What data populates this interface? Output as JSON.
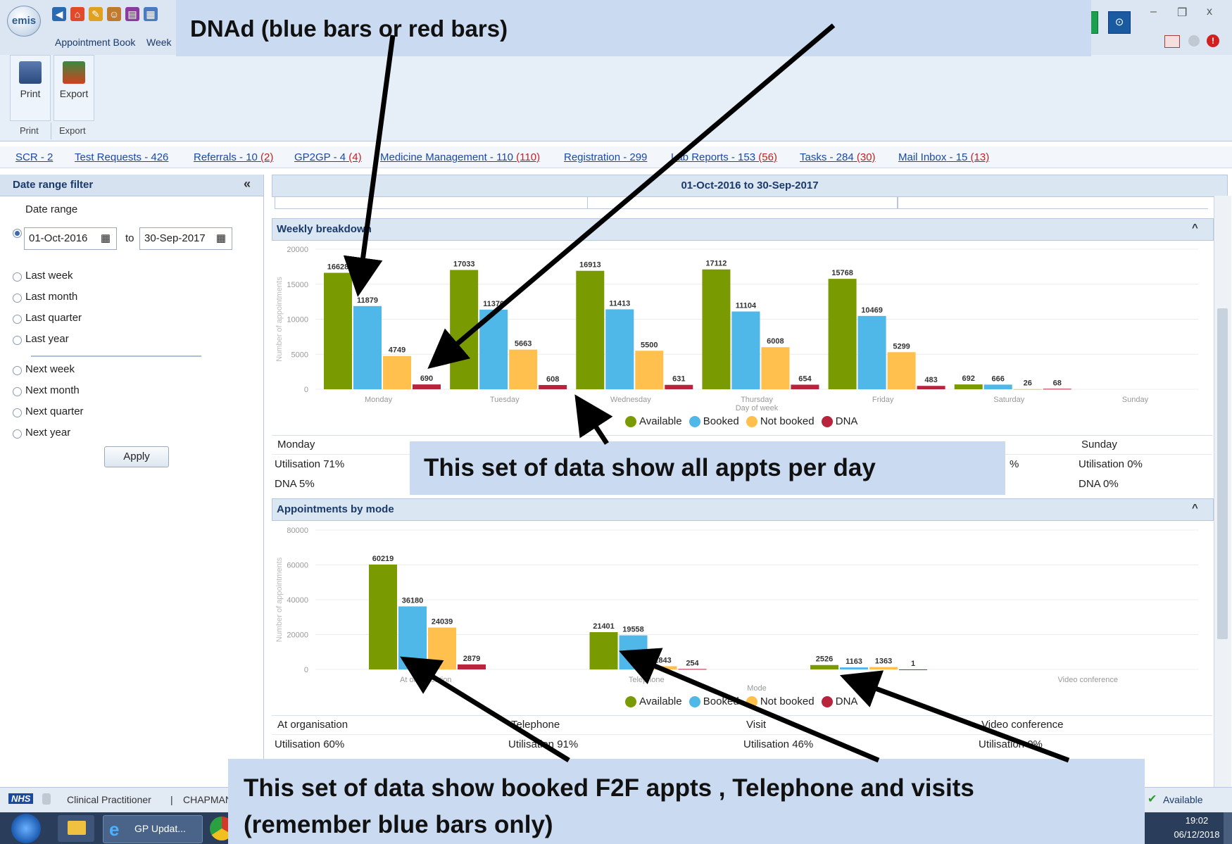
{
  "app": {
    "logo": "emis",
    "menu_tabs": [
      "Appointment Book",
      "Week"
    ],
    "ribbon_buttons": [
      {
        "label": "Print",
        "icon": "printer-icon"
      },
      {
        "label": "Export",
        "icon": "export-icon"
      }
    ],
    "ribbon_groups": [
      "Print",
      "Export"
    ]
  },
  "links": [
    {
      "label": "SCR",
      "count": " - 2",
      "extra": ""
    },
    {
      "label": "Test Requests",
      "count": " - 426",
      "extra": ""
    },
    {
      "label": "Referrals",
      "count": " - 10",
      "extra": " (2)"
    },
    {
      "label": "GP2GP",
      "count": " - 4",
      "extra": " (4)"
    },
    {
      "label": "Medicine Management",
      "count": " - 110",
      "extra": " (110)"
    },
    {
      "label": "Registration",
      "count": " - 299",
      "extra": ""
    },
    {
      "label": "Lab Reports",
      "count": " - 153",
      "extra": " (56)"
    },
    {
      "label": "Tasks",
      "count": " - 284",
      "extra": " (30)"
    },
    {
      "label": "Mail Inbox",
      "count": " - 15",
      "extra": " (13)"
    }
  ],
  "filter": {
    "title": "Date range filter",
    "collapse": "«",
    "date_range_label": "Date range",
    "from": "01-Oct-2016",
    "to_label": "to",
    "to": "30-Sep-2017",
    "options_past": [
      "Last week",
      "Last month",
      "Last quarter",
      "Last year"
    ],
    "options_next": [
      "Next week",
      "Next month",
      "Next quarter",
      "Next year"
    ],
    "apply": "Apply"
  },
  "main": {
    "period": "01-Oct-2016 to 30-Sep-2017",
    "weekly_title": "Weekly breakdown",
    "mode_title": "Appointments by mode",
    "collapse_icon": "^",
    "weekly_summary": [
      {
        "day": "Monday",
        "util": "Utilisation 71%",
        "dna": "DNA 5%"
      },
      {
        "day": "Sunday",
        "util": "Utilisation 0%",
        "dna": "DNA 0%"
      }
    ],
    "mode_summary": [
      {
        "mode": "At organisation",
        "util": "Utilisation 60%"
      },
      {
        "mode": "Telephone",
        "util": "Utilisation 91%"
      },
      {
        "mode": "Visit",
        "util": "Utilisation 46%"
      },
      {
        "mode": "Video conference",
        "util": "Utilisation 0%"
      }
    ],
    "partial_right_weekly": "%"
  },
  "legend": [
    "Available",
    "Booked",
    "Not booked",
    "DNA"
  ],
  "colors": {
    "available": "#7a9a01",
    "booked": "#4fb8e8",
    "not_booked": "#ffc04d",
    "dna": "#b8243c"
  },
  "chart_data": [
    {
      "type": "bar",
      "ylabel": "Number of appointments",
      "xlabel": "Day of week",
      "ylim": [
        0,
        20000
      ],
      "yticks": [
        0,
        5000,
        10000,
        15000,
        20000
      ],
      "categories": [
        "Monday",
        "Tuesday",
        "Wednesday",
        "Thursday",
        "Friday",
        "Saturday",
        "Sunday"
      ],
      "series": [
        {
          "name": "Available",
          "values": [
            16628,
            17033,
            16913,
            17112,
            15768,
            692,
            0
          ]
        },
        {
          "name": "Booked",
          "values": [
            11879,
            11370,
            11413,
            11104,
            10469,
            666,
            0
          ]
        },
        {
          "name": "Not booked",
          "values": [
            4749,
            5663,
            5500,
            6008,
            5299,
            26,
            0
          ]
        },
        {
          "name": "DNA",
          "values": [
            690,
            608,
            631,
            654,
            483,
            68,
            0
          ]
        }
      ]
    },
    {
      "type": "bar",
      "ylabel": "Number of appointments",
      "xlabel": "Mode",
      "ylim": [
        0,
        80000
      ],
      "yticks": [
        0,
        20000,
        40000,
        60000,
        80000
      ],
      "categories": [
        "At organisation",
        "Telephone",
        "Visit",
        "Video conference"
      ],
      "series": [
        {
          "name": "Available",
          "values": [
            60219,
            21401,
            2526,
            0
          ]
        },
        {
          "name": "Booked",
          "values": [
            36180,
            19558,
            1163,
            0
          ]
        },
        {
          "name": "Not booked",
          "values": [
            24039,
            1843,
            1363,
            0
          ]
        },
        {
          "name": "DNA",
          "values": [
            2879,
            254,
            1,
            0
          ]
        }
      ]
    }
  ],
  "callouts": {
    "top_line2": "DNAd (blue bars or red bars)",
    "weekly": "This set of data show all appts per day",
    "mode_line1": "This set of data show booked F2F appts , Telephone and visits",
    "mode_line2": "(remember blue bars only)"
  },
  "status": {
    "nhs": "NHS",
    "role": "Clinical Practitioner",
    "sep": "|",
    "user": "CHAPMAN",
    "availability": "Available",
    "time": "19:02",
    "date": "06/12/2018",
    "task_window": "GP Updat..."
  }
}
